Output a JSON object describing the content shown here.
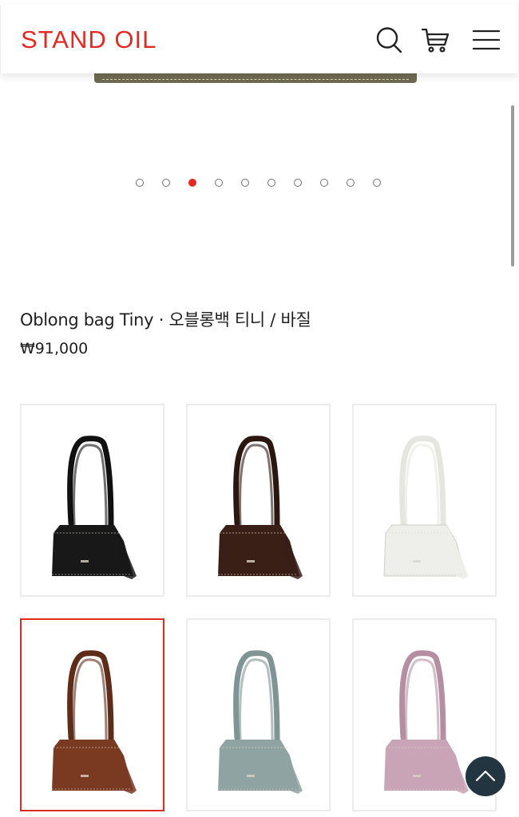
{
  "header": {
    "logo": "STAND OIL",
    "icons": [
      "search-icon",
      "cart-icon",
      "menu-icon"
    ]
  },
  "carousel": {
    "dot_count": 10,
    "active_index": 2,
    "accent": "#e32a22"
  },
  "product": {
    "title": "Oblong bag Tiny · 오블롱백 티니 / 바질",
    "price": "₩91,000"
  },
  "variants": [
    {
      "name": "black",
      "color": "#181818",
      "strap": "#101010",
      "selected": false
    },
    {
      "name": "dark-brown",
      "color": "#3a1f17",
      "strap": "#2b1610",
      "selected": false
    },
    {
      "name": "cream",
      "color": "#eeeeea",
      "strap": "#e6e6e0",
      "selected": false
    },
    {
      "name": "brown",
      "color": "#7a3a22",
      "strap": "#5e2c18",
      "selected": true
    },
    {
      "name": "sage-blue",
      "color": "#8fa3a2",
      "strap": "#7f9594",
      "selected": false
    },
    {
      "name": "lilac-pink",
      "color": "#c9a3b6",
      "strap": "#b58ea2",
      "selected": false
    }
  ],
  "colors": {
    "brand": "#e32a22",
    "scroll_top_button": "#233540"
  }
}
